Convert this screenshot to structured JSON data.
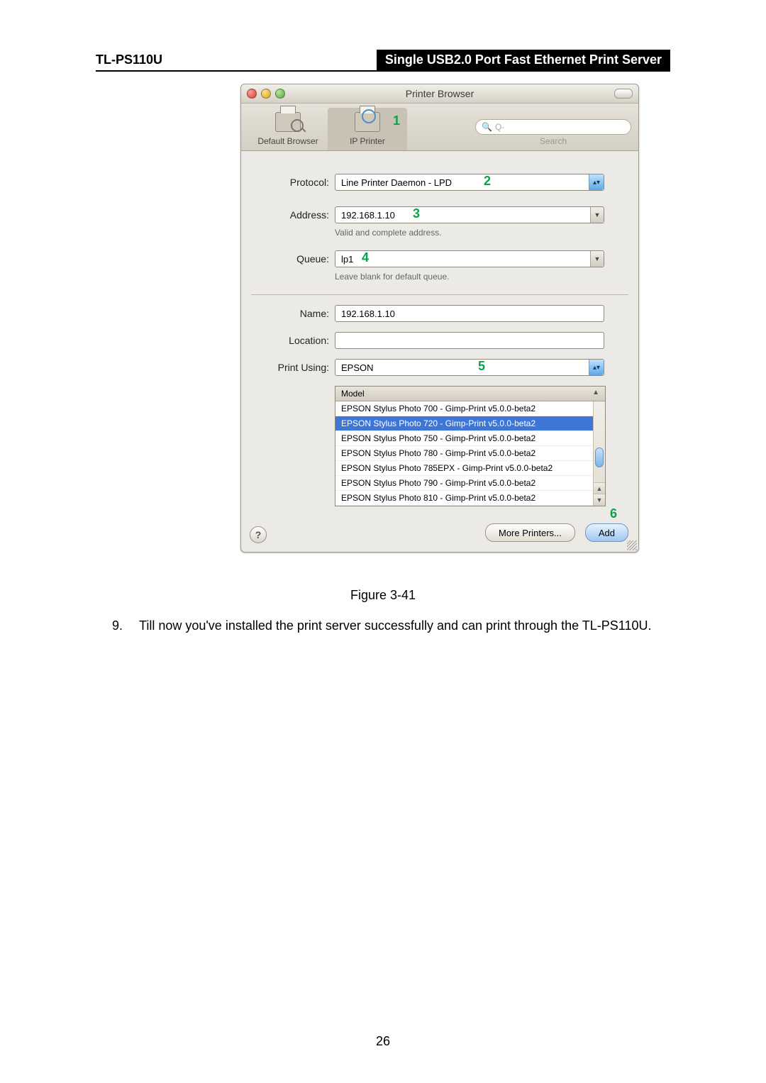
{
  "header": {
    "model": "TL-PS110U",
    "title": "Single USB2.0 Port Fast Ethernet Print Server"
  },
  "window": {
    "title": "Printer Browser",
    "toolbar": {
      "default_browser": "Default Browser",
      "ip_printer": "IP Printer",
      "search_label": "Search",
      "search_placeholder": "Q-"
    },
    "form": {
      "protocol_label": "Protocol:",
      "protocol_value": "Line Printer Daemon - LPD",
      "address_label": "Address:",
      "address_value": "192.168.1.10",
      "address_hint": "Valid and complete address.",
      "queue_label": "Queue:",
      "queue_value": "lp1",
      "queue_hint": "Leave blank for default queue.",
      "name_label": "Name:",
      "name_value": "192.168.1.10",
      "location_label": "Location:",
      "location_value": "",
      "printusing_label": "Print Using:",
      "printusing_value": "EPSON",
      "model_header": "Model",
      "models": [
        "EPSON Stylus Photo 700 - Gimp-Print v5.0.0-beta2",
        "EPSON Stylus Photo 720 - Gimp-Print v5.0.0-beta2",
        "EPSON Stylus Photo 750 - Gimp-Print v5.0.0-beta2",
        "EPSON Stylus Photo 780 - Gimp-Print v5.0.0-beta2",
        "EPSON Stylus Photo 785EPX - Gimp-Print v5.0.0-beta2",
        "EPSON Stylus Photo 790 - Gimp-Print v5.0.0-beta2",
        "EPSON Stylus Photo 810 - Gimp-Print v5.0.0-beta2"
      ],
      "selected_model_index": 1
    },
    "buttons": {
      "more": "More Printers...",
      "add": "Add",
      "help": "?"
    }
  },
  "callouts": {
    "c1": "1",
    "c2": "2",
    "c3": "3",
    "c4": "4",
    "c5": "5",
    "c6": "6"
  },
  "caption": "Figure 3-41",
  "body": {
    "num": "9.",
    "text": "Till now you've installed the print server successfully and can print through the TL-PS110U."
  },
  "page_number": "26"
}
